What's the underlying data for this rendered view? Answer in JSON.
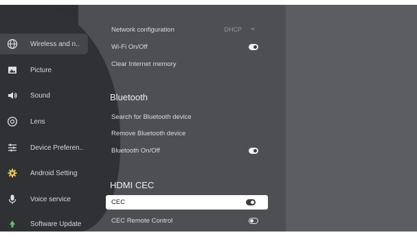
{
  "sidebar": {
    "items": [
      {
        "label": "Wireless and n..",
        "icon": "globe-icon"
      },
      {
        "label": "Picture",
        "icon": "picture-icon"
      },
      {
        "label": "Sound",
        "icon": "speaker-icon"
      },
      {
        "label": "Lens",
        "icon": "lens-icon"
      },
      {
        "label": "Device Preferen..",
        "icon": "sliders-icon"
      },
      {
        "label": "Android Setting",
        "icon": "gear-icon"
      },
      {
        "label": "Voice service",
        "icon": "microphone-icon"
      },
      {
        "label": "Software Update",
        "icon": "update-icon"
      }
    ]
  },
  "main": {
    "network_configuration": {
      "label": "Network configuration",
      "value": "DHCP"
    },
    "wifi_toggle": {
      "label": "Wi-Fi On/Off",
      "state": "on"
    },
    "clear_memory": {
      "label": "Clear Internet memory"
    },
    "bluetooth_heading": "Bluetooth",
    "bt_search": {
      "label": "Search for Bluetooth device"
    },
    "bt_remove": {
      "label": "Remove Bluetooth device"
    },
    "bt_toggle": {
      "label": "Bluetooth On/Off",
      "state": "on"
    },
    "hdmi_heading": "HDMI CEC",
    "cec": {
      "label": "CEC",
      "state": "on"
    },
    "cec_remote": {
      "label": "CEC Remote Control",
      "state": "off"
    }
  },
  "colors": {
    "background": "#2f3033",
    "panel": "#4e4f52",
    "selected": "#ffffff"
  }
}
